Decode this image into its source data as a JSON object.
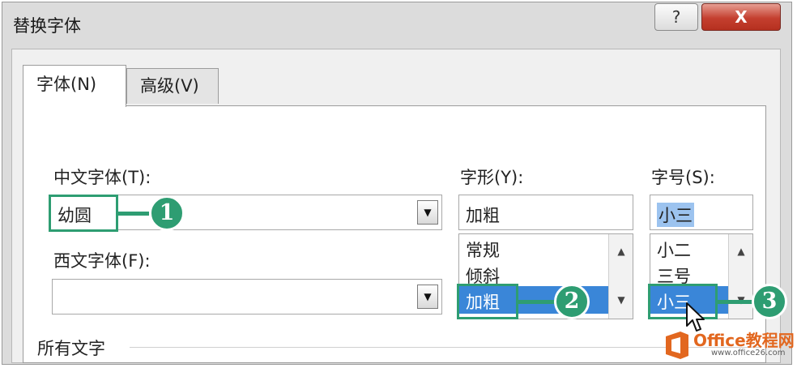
{
  "window": {
    "title": "替换字体",
    "help_label": "?",
    "close_label": "X"
  },
  "tabs": [
    {
      "label": "字体(N)",
      "active": true
    },
    {
      "label": "高级(V)",
      "active": false
    }
  ],
  "chinese_font": {
    "label": "中文字体(T):",
    "value": "幼圆"
  },
  "western_font": {
    "label": "西文字体(F):",
    "value": ""
  },
  "font_style": {
    "label": "字形(Y):",
    "value": "加粗",
    "options": [
      "常规",
      "倾斜",
      "加粗"
    ],
    "selected": "加粗"
  },
  "font_size": {
    "label": "字号(S):",
    "value": "小三",
    "options": [
      "小二",
      "三号",
      "小三"
    ],
    "selected": "小三"
  },
  "section": {
    "all_text": "所有文字"
  },
  "callouts": [
    "1",
    "2",
    "3"
  ],
  "watermark": {
    "title": "Office教程网",
    "url": "www.office26.com"
  },
  "colors": {
    "callout": "#2e9d72",
    "selection": "#3a86d8",
    "close_button": "#c43f2f",
    "watermark": "#e2671f"
  },
  "icons": [
    "help-icon",
    "close-icon",
    "dropdown-arrow-icon",
    "scroll-up-icon",
    "scroll-down-icon",
    "mouse-cursor-icon",
    "office-logo-icon"
  ]
}
